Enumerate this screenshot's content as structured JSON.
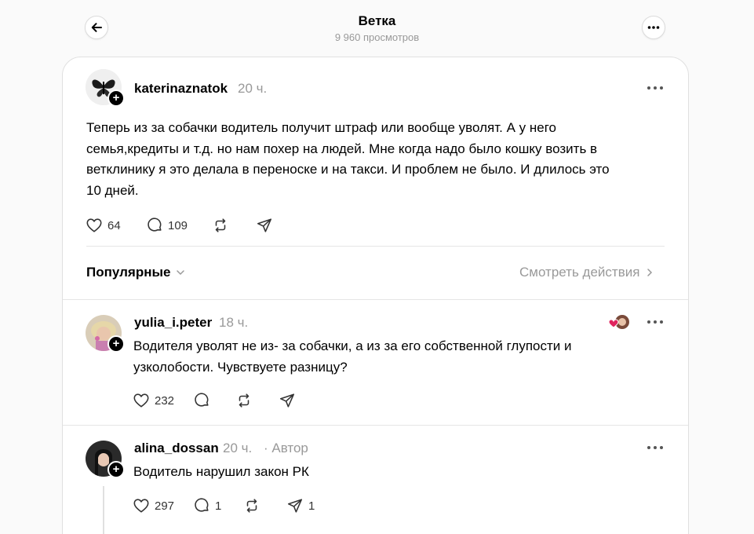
{
  "header": {
    "title": "Ветка",
    "views": "9 960 просмотров"
  },
  "main_post": {
    "username": "katerinaznatok",
    "time": "20 ч.",
    "text_lines": [
      "Теперь из за собачки водитель получит штраф или вообще уволят. А у него",
      "семья,кредиты и т.д. но нам похер на людей. Мне когда надо было кошку возить в",
      "ветклинику я это делала в переноске и на такси. И проблем не было. И длилось это",
      "10 дней."
    ],
    "likes": "64",
    "replies": "109",
    "reposts": "",
    "shares": ""
  },
  "sort": {
    "label": "Популярные",
    "activity_label": "Смотреть действия"
  },
  "replies": [
    {
      "username": "yulia_i.peter",
      "time": "18 ч.",
      "text_lines": [
        "Водителя уволят не из- за собачки, а из за его собственной глупости и",
        "узколобости. Чувствуете разницу?"
      ],
      "likes": "232",
      "replies": "",
      "reposts": "",
      "shares": ""
    },
    {
      "username": "alina_dossan",
      "time": "20 ч.",
      "author_tag": "· Автор",
      "text_lines": [
        "Водитель нарушил закон РК"
      ],
      "likes": "297",
      "replies": "1",
      "reposts": "",
      "shares": "1"
    }
  ],
  "colors": {
    "heart_badge": "#e0245e",
    "muted": "#999999"
  }
}
